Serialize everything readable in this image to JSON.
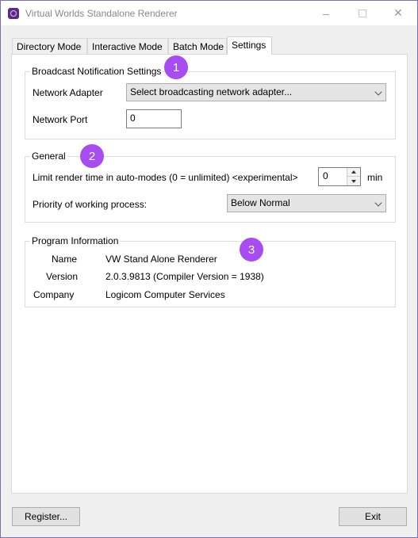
{
  "window": {
    "title": "Virtual Worlds Standalone Renderer",
    "icon": "app-icon",
    "controls": {
      "minimize": "–",
      "close": "✕"
    }
  },
  "tabs": [
    {
      "label": "Directory Mode",
      "active": false
    },
    {
      "label": "Interactive Mode",
      "active": false
    },
    {
      "label": "Batch Mode",
      "active": false
    },
    {
      "label": "Settings",
      "active": true
    }
  ],
  "broadcast": {
    "title": "Broadcast Notification Settings",
    "adapter_label": "Network Adapter",
    "adapter_value": "Select broadcasting network adapter...",
    "port_label": "Network Port",
    "port_value": "0"
  },
  "general": {
    "title": "General",
    "limit_label": "Limit render time in auto-modes (0 = unlimited) <experimental>",
    "limit_value": "0",
    "limit_unit": "min",
    "priority_label": "Priority of working process:",
    "priority_value": "Below Normal"
  },
  "program_info": {
    "title": "Program Information",
    "rows": [
      {
        "key": "Name",
        "value": "VW Stand Alone Renderer"
      },
      {
        "key": "Version",
        "value": "2.0.3.9813 (Compiler Version = 1938)"
      },
      {
        "key": "Company",
        "value": "Logicom Computer Services"
      }
    ]
  },
  "badges": [
    "1",
    "2",
    "3"
  ],
  "footer": {
    "register_label": "Register...",
    "exit_label": "Exit"
  },
  "colors": {
    "badge": "#a64cf0",
    "window_border": "#7a6fb0"
  }
}
